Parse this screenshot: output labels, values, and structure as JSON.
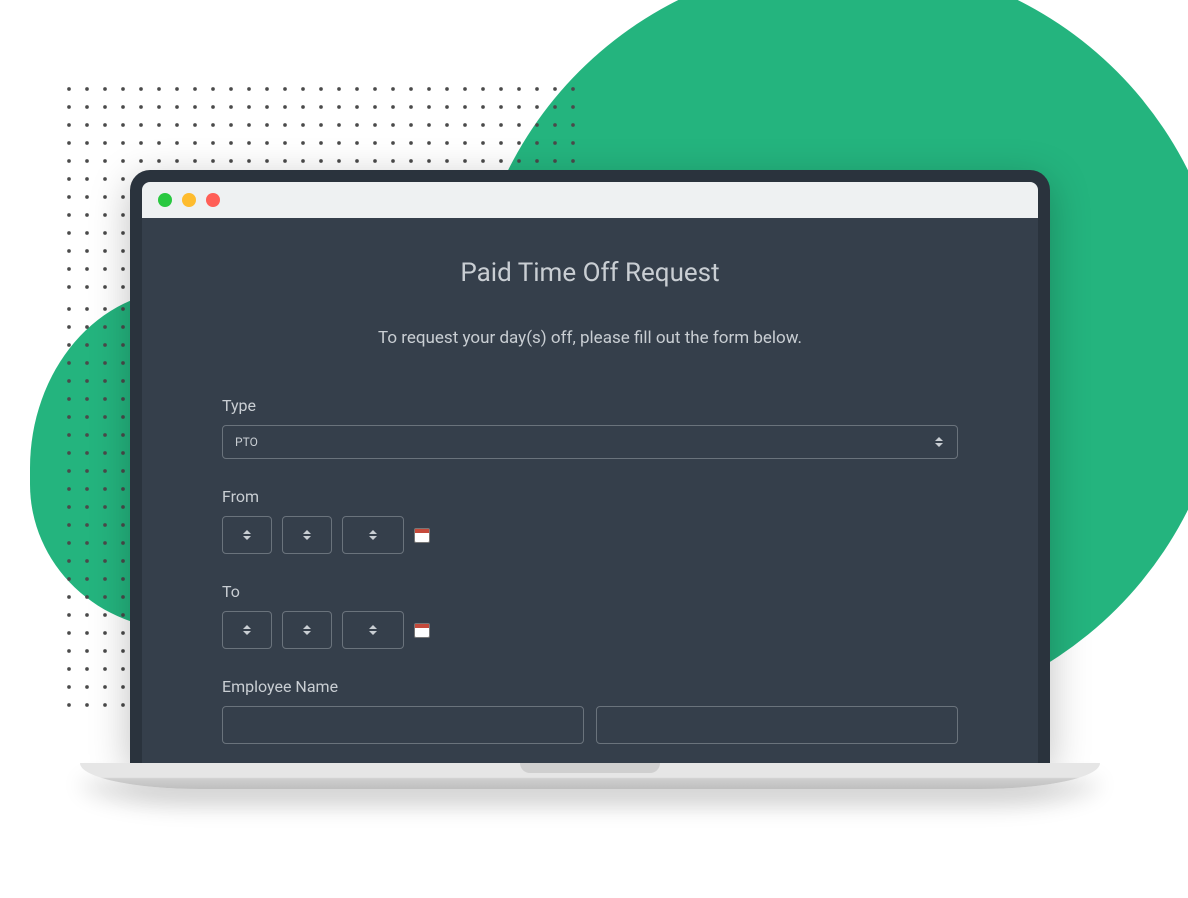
{
  "form": {
    "title": "Paid Time Off Request",
    "subtitle": "To request your day(s) off, please fill out the form below.",
    "type_label": "Type",
    "type_value": "PTO",
    "from_label": "From",
    "to_label": "To",
    "employee_name_label": "Employee Name"
  }
}
